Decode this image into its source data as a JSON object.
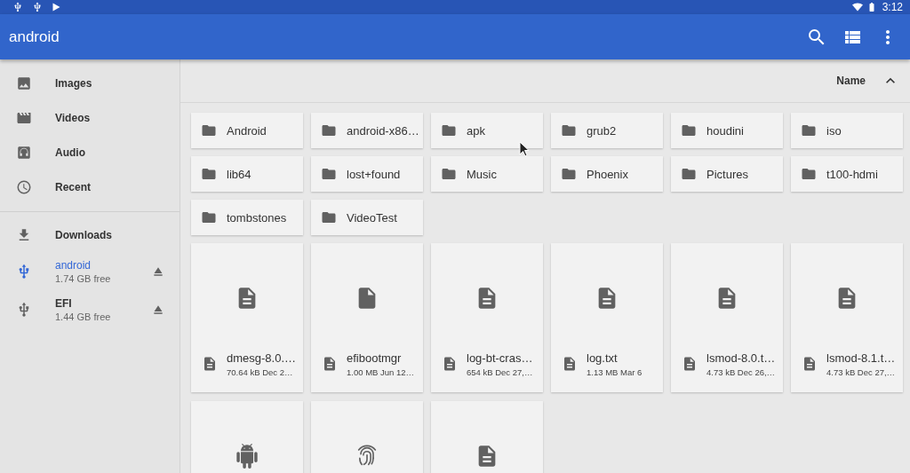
{
  "status_bar": {
    "time": "3:12"
  },
  "app_bar": {
    "title": "android"
  },
  "sidebar": {
    "sections": [
      {
        "items": [
          {
            "label": "Images",
            "selected": false
          },
          {
            "label": "Videos",
            "selected": false
          },
          {
            "label": "Audio",
            "selected": false
          },
          {
            "label": "Recent",
            "selected": false
          }
        ]
      },
      {
        "items": [
          {
            "label": "Downloads",
            "selected": false
          },
          {
            "label": "android",
            "detail": "1.74 GB free",
            "ejectable": true,
            "selected": true
          },
          {
            "label": "EFI",
            "detail": "1.44 GB free",
            "ejectable": true,
            "selected": false
          }
        ]
      }
    ]
  },
  "sort": {
    "label": "Name",
    "ascending": true
  },
  "folders": [
    "Android",
    "android-x86…",
    "apk",
    "grub2",
    "houdini",
    "iso",
    "lib64",
    "lost+found",
    "Music",
    "Phoenix",
    "Pictures",
    "t100-hdmi",
    "tombstones",
    "VideoTest"
  ],
  "files": [
    {
      "kind": "doc",
      "name": "dmesg-8.0.…",
      "details": "70.64 kB Dec 2…"
    },
    {
      "kind": "file",
      "name": "efibootmgr",
      "details": "1.00 MB Jun 12…"
    },
    {
      "kind": "doc",
      "name": "log-bt-cras…",
      "details": "654 kB Dec 27,…"
    },
    {
      "kind": "doc",
      "name": "log.txt",
      "details": "1.13 MB Mar 6"
    },
    {
      "kind": "doc",
      "name": "lsmod-8.0.t…",
      "details": "4.73 kB Dec 26,…"
    },
    {
      "kind": "doc",
      "name": "lsmod-8.1.t…",
      "details": "4.73 kB Dec 27,…"
    },
    {
      "kind": "android"
    },
    {
      "kind": "fingerprint"
    },
    {
      "kind": "doc"
    }
  ]
}
